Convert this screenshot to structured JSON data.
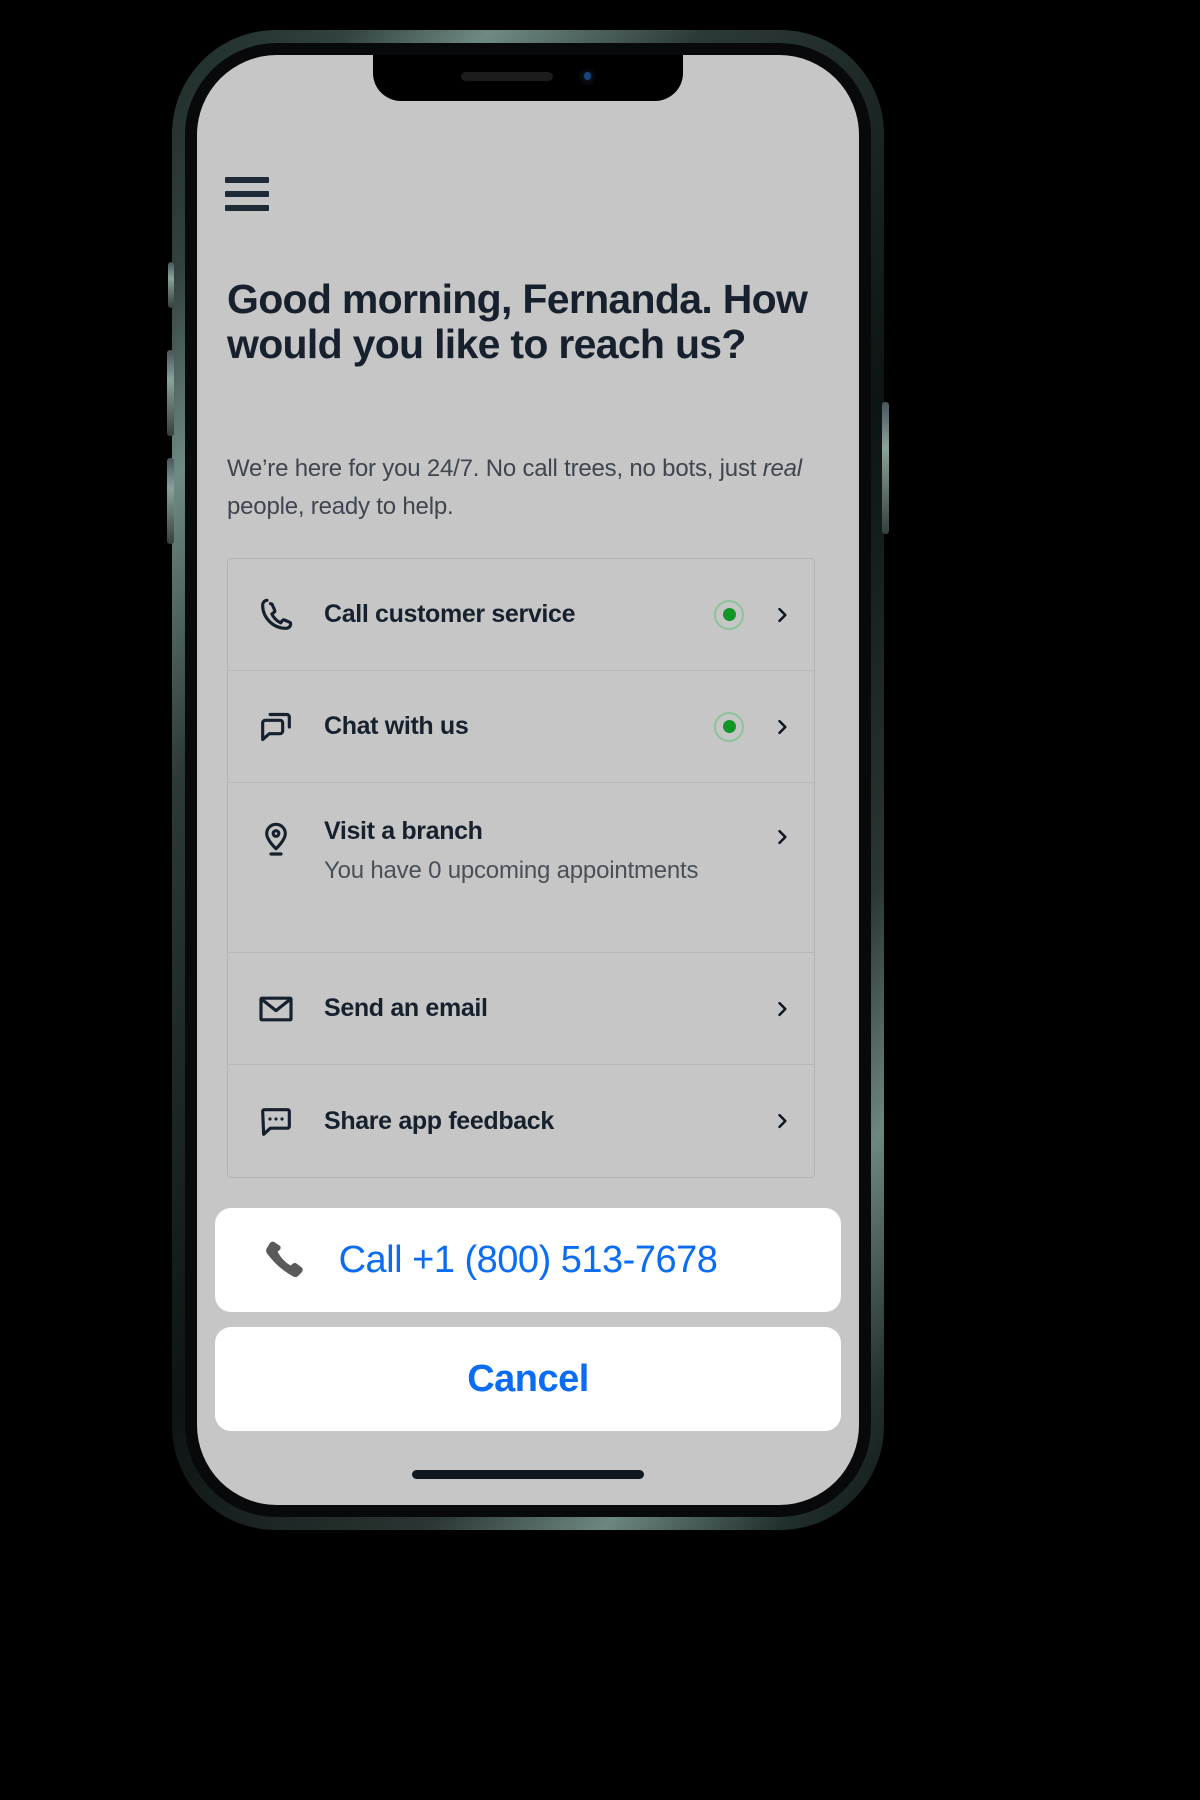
{
  "device": {
    "frame_color": "#32423f",
    "screen_bg": "#c6c6c6"
  },
  "header": {
    "menu_icon": "hamburger-menu-icon"
  },
  "main": {
    "headline": "Good morning, Fernanda. How would you like to reach us?",
    "subhead_part1": "We’re here for you 24/7. No call trees, no bots, just ",
    "subhead_emphasis": "real",
    "subhead_part2": " people, ready to help."
  },
  "options": [
    {
      "icon": "phone-icon",
      "title": "Call customer service",
      "sub": null,
      "status": "online",
      "status_color": "#119628",
      "chevron": "chevron-right-icon"
    },
    {
      "icon": "chat-bubble-icon",
      "title": "Chat with us",
      "sub": null,
      "status": "online",
      "status_color": "#119628",
      "chevron": "chevron-right-icon"
    },
    {
      "icon": "location-pin-icon",
      "title": "Visit a branch",
      "sub": "You have 0 upcoming appointments",
      "status": null,
      "chevron": "chevron-right-icon"
    },
    {
      "icon": "envelope-icon",
      "title": "Send an email",
      "sub": null,
      "status": null,
      "chevron": "chevron-right-icon"
    },
    {
      "icon": "feedback-bubble-icon",
      "title": "Share app feedback",
      "sub": null,
      "status": null,
      "chevron": "chevron-right-icon"
    }
  ],
  "action_sheet": {
    "call_label": "Call +1 (800) 513-7678",
    "call_icon": "phone-handset-icon",
    "cancel_label": "Cancel",
    "accent_color": "#0a6cf5"
  }
}
